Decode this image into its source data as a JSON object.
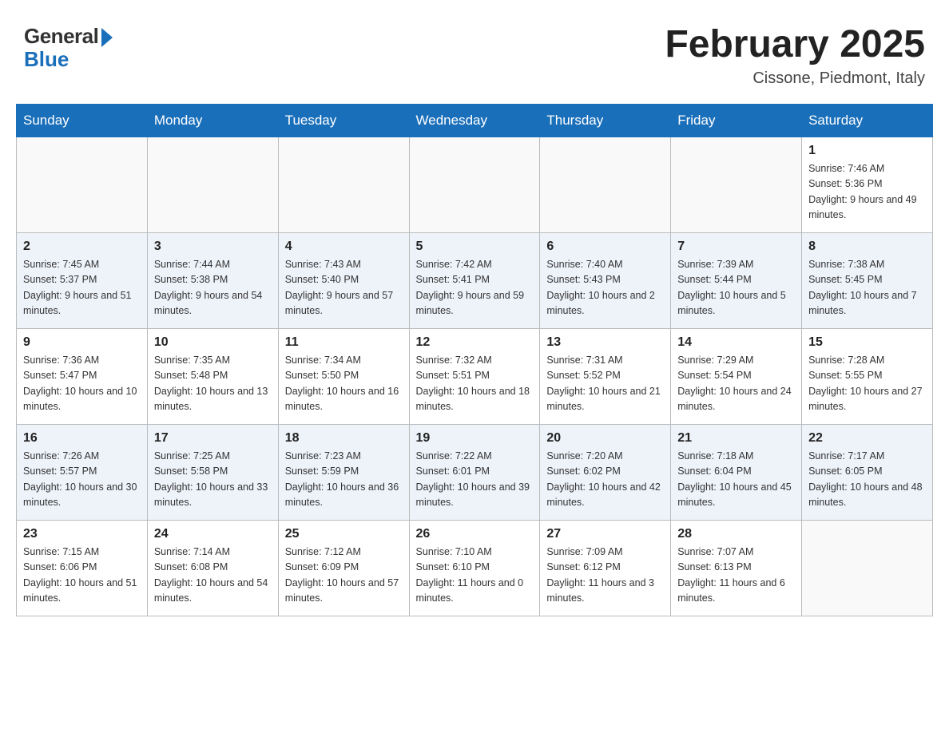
{
  "header": {
    "logo_general": "General",
    "logo_blue": "Blue",
    "month_title": "February 2025",
    "location": "Cissone, Piedmont, Italy"
  },
  "days_of_week": [
    "Sunday",
    "Monday",
    "Tuesday",
    "Wednesday",
    "Thursday",
    "Friday",
    "Saturday"
  ],
  "weeks": [
    [
      {
        "day": "",
        "info": ""
      },
      {
        "day": "",
        "info": ""
      },
      {
        "day": "",
        "info": ""
      },
      {
        "day": "",
        "info": ""
      },
      {
        "day": "",
        "info": ""
      },
      {
        "day": "",
        "info": ""
      },
      {
        "day": "1",
        "info": "Sunrise: 7:46 AM\nSunset: 5:36 PM\nDaylight: 9 hours and 49 minutes."
      }
    ],
    [
      {
        "day": "2",
        "info": "Sunrise: 7:45 AM\nSunset: 5:37 PM\nDaylight: 9 hours and 51 minutes."
      },
      {
        "day": "3",
        "info": "Sunrise: 7:44 AM\nSunset: 5:38 PM\nDaylight: 9 hours and 54 minutes."
      },
      {
        "day": "4",
        "info": "Sunrise: 7:43 AM\nSunset: 5:40 PM\nDaylight: 9 hours and 57 minutes."
      },
      {
        "day": "5",
        "info": "Sunrise: 7:42 AM\nSunset: 5:41 PM\nDaylight: 9 hours and 59 minutes."
      },
      {
        "day": "6",
        "info": "Sunrise: 7:40 AM\nSunset: 5:43 PM\nDaylight: 10 hours and 2 minutes."
      },
      {
        "day": "7",
        "info": "Sunrise: 7:39 AM\nSunset: 5:44 PM\nDaylight: 10 hours and 5 minutes."
      },
      {
        "day": "8",
        "info": "Sunrise: 7:38 AM\nSunset: 5:45 PM\nDaylight: 10 hours and 7 minutes."
      }
    ],
    [
      {
        "day": "9",
        "info": "Sunrise: 7:36 AM\nSunset: 5:47 PM\nDaylight: 10 hours and 10 minutes."
      },
      {
        "day": "10",
        "info": "Sunrise: 7:35 AM\nSunset: 5:48 PM\nDaylight: 10 hours and 13 minutes."
      },
      {
        "day": "11",
        "info": "Sunrise: 7:34 AM\nSunset: 5:50 PM\nDaylight: 10 hours and 16 minutes."
      },
      {
        "day": "12",
        "info": "Sunrise: 7:32 AM\nSunset: 5:51 PM\nDaylight: 10 hours and 18 minutes."
      },
      {
        "day": "13",
        "info": "Sunrise: 7:31 AM\nSunset: 5:52 PM\nDaylight: 10 hours and 21 minutes."
      },
      {
        "day": "14",
        "info": "Sunrise: 7:29 AM\nSunset: 5:54 PM\nDaylight: 10 hours and 24 minutes."
      },
      {
        "day": "15",
        "info": "Sunrise: 7:28 AM\nSunset: 5:55 PM\nDaylight: 10 hours and 27 minutes."
      }
    ],
    [
      {
        "day": "16",
        "info": "Sunrise: 7:26 AM\nSunset: 5:57 PM\nDaylight: 10 hours and 30 minutes."
      },
      {
        "day": "17",
        "info": "Sunrise: 7:25 AM\nSunset: 5:58 PM\nDaylight: 10 hours and 33 minutes."
      },
      {
        "day": "18",
        "info": "Sunrise: 7:23 AM\nSunset: 5:59 PM\nDaylight: 10 hours and 36 minutes."
      },
      {
        "day": "19",
        "info": "Sunrise: 7:22 AM\nSunset: 6:01 PM\nDaylight: 10 hours and 39 minutes."
      },
      {
        "day": "20",
        "info": "Sunrise: 7:20 AM\nSunset: 6:02 PM\nDaylight: 10 hours and 42 minutes."
      },
      {
        "day": "21",
        "info": "Sunrise: 7:18 AM\nSunset: 6:04 PM\nDaylight: 10 hours and 45 minutes."
      },
      {
        "day": "22",
        "info": "Sunrise: 7:17 AM\nSunset: 6:05 PM\nDaylight: 10 hours and 48 minutes."
      }
    ],
    [
      {
        "day": "23",
        "info": "Sunrise: 7:15 AM\nSunset: 6:06 PM\nDaylight: 10 hours and 51 minutes."
      },
      {
        "day": "24",
        "info": "Sunrise: 7:14 AM\nSunset: 6:08 PM\nDaylight: 10 hours and 54 minutes."
      },
      {
        "day": "25",
        "info": "Sunrise: 7:12 AM\nSunset: 6:09 PM\nDaylight: 10 hours and 57 minutes."
      },
      {
        "day": "26",
        "info": "Sunrise: 7:10 AM\nSunset: 6:10 PM\nDaylight: 11 hours and 0 minutes."
      },
      {
        "day": "27",
        "info": "Sunrise: 7:09 AM\nSunset: 6:12 PM\nDaylight: 11 hours and 3 minutes."
      },
      {
        "day": "28",
        "info": "Sunrise: 7:07 AM\nSunset: 6:13 PM\nDaylight: 11 hours and 6 minutes."
      },
      {
        "day": "",
        "info": ""
      }
    ]
  ]
}
